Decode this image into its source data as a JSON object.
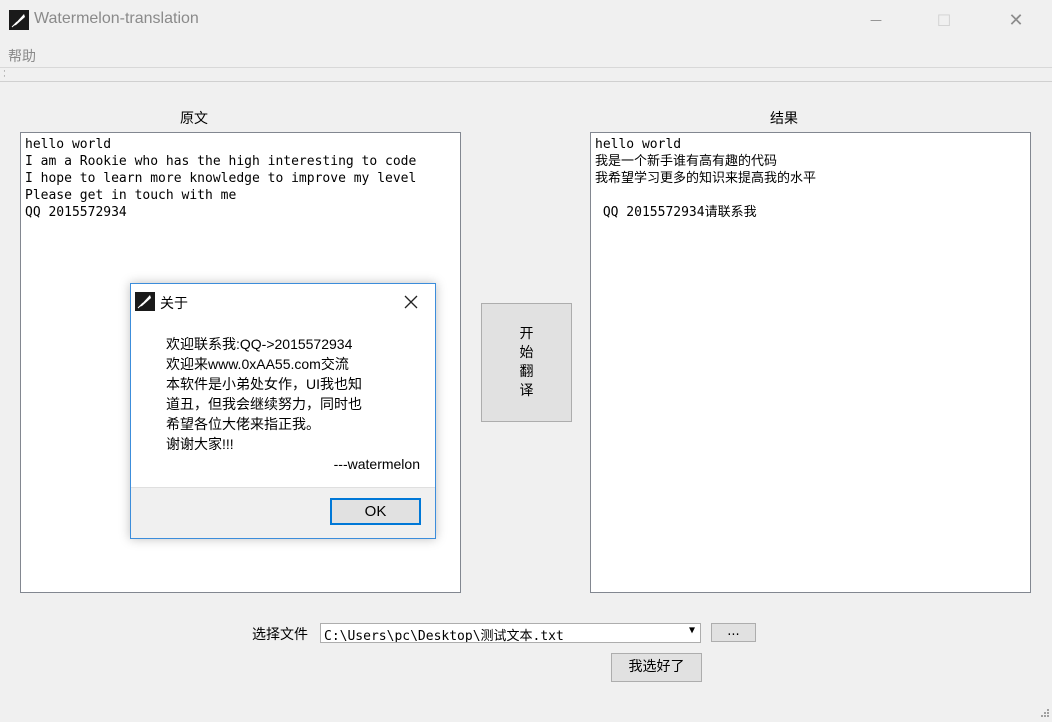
{
  "window": {
    "title": "Watermelon-translation",
    "minimize_glyph": "—",
    "maximize_glyph": "☐",
    "close_glyph": "✕"
  },
  "menu": {
    "help": "帮助"
  },
  "source": {
    "label": "原文",
    "text": "hello world\nI am a Rookie who has the high interesting to code\nI hope to learn more knowledge to improve my level\nPlease get in touch with me\nQQ 2015572934"
  },
  "result": {
    "label": "结果",
    "text": "hello world\n我是一个新手谁有高有趣的代码\n我希望学习更多的知识来提高我的水平\n\n QQ 2015572934请联系我"
  },
  "translate_button": "开始翻译",
  "file": {
    "label": "选择文件",
    "path": "C:\\Users\\pc\\Desktop\\测试文本.txt",
    "browse_label": "...",
    "done_label": "我选好了"
  },
  "about_dialog": {
    "title": "关于",
    "lines": [
      "欢迎联系我:QQ->2015572934",
      "欢迎来www.0xAA55.com交流",
      "本软件是小弟处女作，UI我也知",
      "道丑，但我会继续努力，同时也",
      "希望各位大佬来指正我。",
      "谢谢大家!!!"
    ],
    "signature": "---watermelon",
    "ok_label": "OK"
  },
  "icons": {
    "app": "feather-icon",
    "close": "close-icon",
    "dropdown": "chevron-down-icon"
  },
  "colors": {
    "accent": "#0078d7",
    "dialog_border": "#3c8ddb"
  }
}
